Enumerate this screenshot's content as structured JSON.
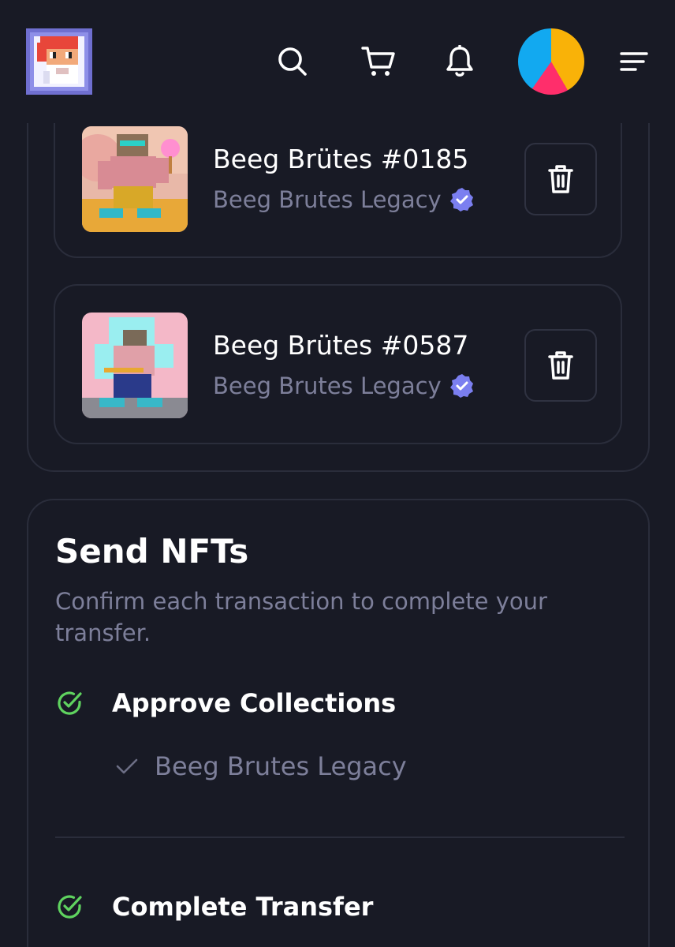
{
  "header": {
    "logo_icon": "pixel-avatar-logo",
    "icons": [
      "search-icon",
      "cart-icon",
      "bell-icon",
      "avatar",
      "menu-icon"
    ]
  },
  "cart_items": [
    {
      "title": "Beeg Brütes #0185",
      "collection": "Beeg Brutes Legacy",
      "verified": true
    },
    {
      "title": "Beeg Brütes #0587",
      "collection": "Beeg Brutes Legacy",
      "verified": true
    }
  ],
  "send": {
    "title": "Send NFTs",
    "description": "Confirm each transaction to complete your transfer.",
    "steps": [
      {
        "label": "Approve Collections",
        "done": true,
        "sub_items": [
          {
            "label": "Beeg Brutes Legacy",
            "done": true
          }
        ]
      },
      {
        "label": "Complete Transfer",
        "done": true
      }
    ]
  },
  "colors": {
    "background": "#181a25",
    "border": "#2a2d3b",
    "muted_text": "#7d7f9a",
    "verified_badge": "#7b7ff0",
    "success": "#5fd35f"
  }
}
